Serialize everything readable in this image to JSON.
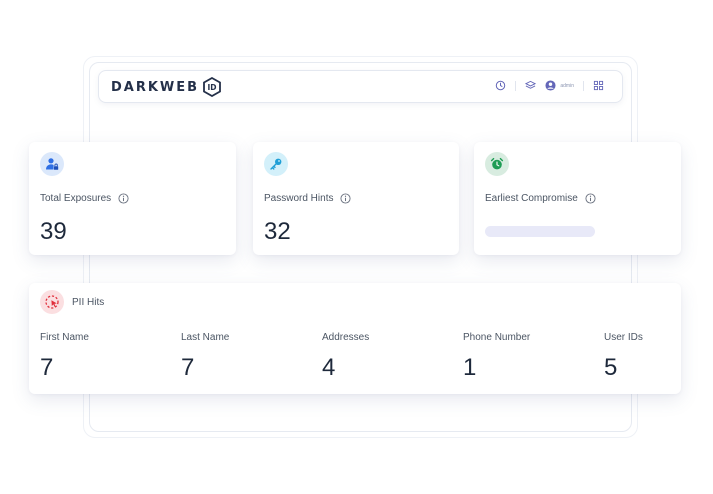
{
  "app": {
    "logo_text": "DARKWEB",
    "logo_badge": "ID",
    "username": "admin"
  },
  "icons": {
    "topbar": [
      "clock-icon",
      "layers-icon",
      "user-avatar-icon",
      "grid-icon"
    ],
    "total_exposures": "user-lock-icon",
    "password_hints": "key-icon",
    "earliest_compromise": "alarm-clock-icon",
    "pii_hits": "cursor-target-icon",
    "info": "info-icon"
  },
  "colors": {
    "user_icon_bg": "#dbe8fb",
    "user_icon_fg": "#2f6fe4",
    "key_icon_bg": "#d3f0fa",
    "key_icon_fg": "#1f9fd6",
    "clock_icon_bg": "#d8ece0",
    "clock_icon_fg": "#1f9d55",
    "pii_icon_bg": "#fbdfe1",
    "pii_icon_fg": "#e0303c",
    "progress_track": "#e8e9f8"
  },
  "cards": {
    "total_exposures": {
      "label": "Total Exposures",
      "value": "39"
    },
    "password_hints": {
      "label": "Password Hints",
      "value": "32"
    },
    "earliest_compromise": {
      "label": "Earliest Compromise"
    }
  },
  "pii": {
    "title": "PII Hits",
    "items": [
      {
        "label": "First Name",
        "value": "7"
      },
      {
        "label": "Last Name",
        "value": "7"
      },
      {
        "label": "Addresses",
        "value": "4"
      },
      {
        "label": "Phone Number",
        "value": "1"
      },
      {
        "label": "User IDs",
        "value": "5"
      }
    ]
  }
}
